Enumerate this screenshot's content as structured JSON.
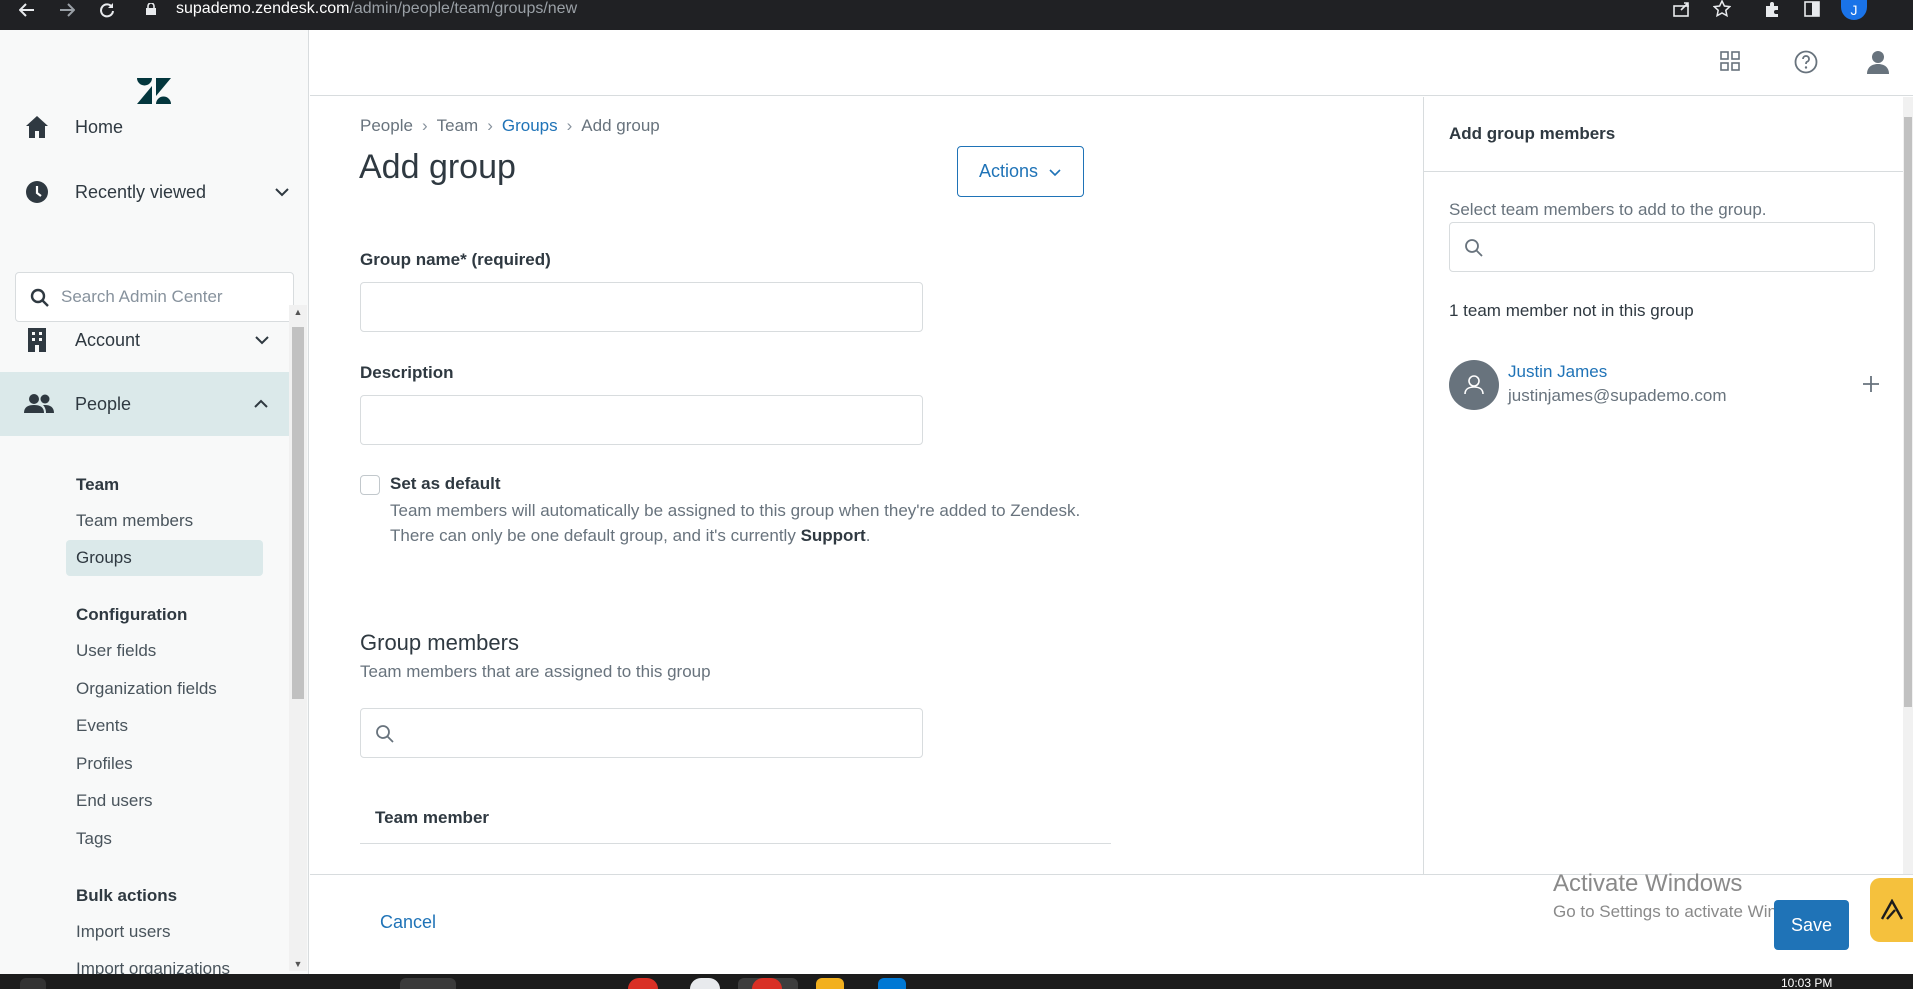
{
  "browser": {
    "url_host": "supademo.zendesk.com",
    "url_path": "/admin/people/team/groups/new",
    "profile_initial": "J"
  },
  "sidebar": {
    "home_label": "Home",
    "recently_viewed_label": "Recently viewed",
    "search_placeholder": "Search Admin Center",
    "account_label": "Account",
    "people_label": "People",
    "team_heading": "Team",
    "team_members": "Team members",
    "groups": "Groups",
    "configuration_heading": "Configuration",
    "user_fields": "User fields",
    "organization_fields": "Organization fields",
    "events": "Events",
    "profiles": "Profiles",
    "end_users": "End users",
    "tags": "Tags",
    "bulk_actions_heading": "Bulk actions",
    "import_users": "Import users",
    "import_organizations": "Import organizations"
  },
  "breadcrumb": {
    "items": [
      "People",
      "Team",
      "Groups",
      "Add group"
    ]
  },
  "page": {
    "title": "Add group",
    "actions_label": "Actions",
    "group_name_label": "Group name* (required)",
    "group_name_value": "",
    "description_label": "Description",
    "description_value": "",
    "set_default_label": "Set as default",
    "set_default_checked": false,
    "default_hint_line1": "Team members will automatically be assigned to this group when they're added to Zendesk.",
    "default_hint_line2_prefix": "There can only be one default group, and it's currently ",
    "default_hint_group": "Support",
    "default_hint_suffix": ".",
    "group_members_title": "Group members",
    "group_members_subtitle": "Team members that are assigned to this group",
    "table_header_team_member": "Team member"
  },
  "right_panel": {
    "title": "Add group members",
    "hint": "Select team members to add to the group.",
    "count_text": "1 team member not in this group",
    "members": [
      {
        "name": "Justin James",
        "email": "justinjames@supademo.com"
      }
    ]
  },
  "footer": {
    "cancel_label": "Cancel",
    "save_label": "Save"
  },
  "watermark": {
    "line1": "Activate Windows",
    "line2": "Go to Settings to activate Windows."
  },
  "taskbar": {
    "time": "10:03 PM"
  },
  "colors": {
    "accent": "#1f73b7",
    "sidebar_active": "#dbe9ea",
    "text_primary": "#2f3941",
    "text_secondary": "#68737d",
    "border": "#d8dcde"
  }
}
